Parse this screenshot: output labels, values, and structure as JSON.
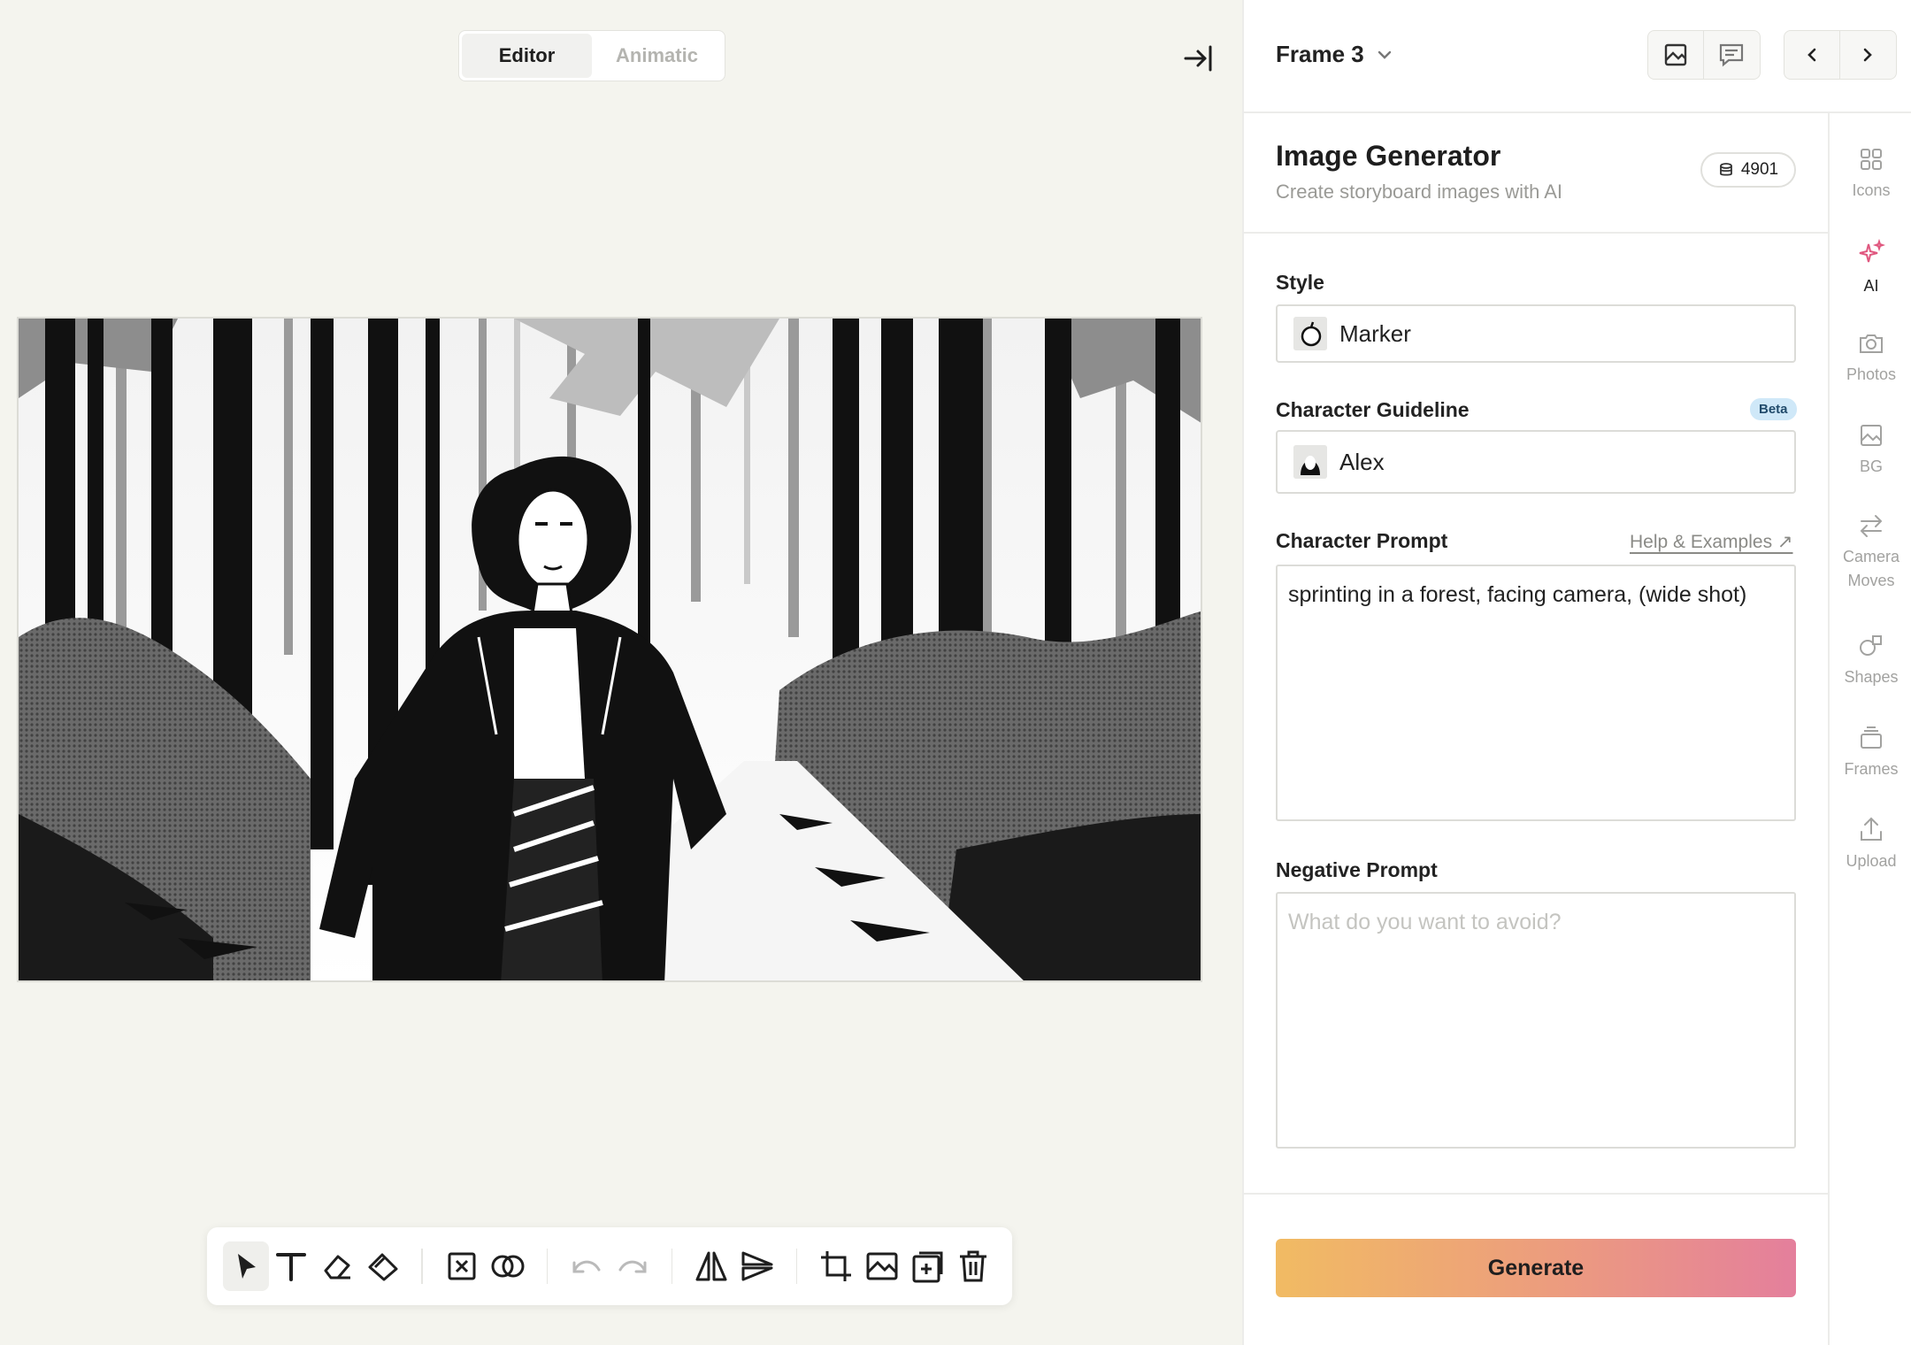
{
  "mode_toggle": {
    "editor": "Editor",
    "animatic": "Animatic",
    "active": "editor"
  },
  "toolbar": {
    "tools": [
      "select-pointer-icon",
      "text-tool-icon",
      "eraser-icon",
      "fill-tool-icon",
      "remove-element-icon",
      "merge-icon",
      "undo-icon",
      "redo-icon",
      "flip-horizontal-icon",
      "flip-vertical-icon",
      "crop-icon",
      "replace-image-icon",
      "add-frame-icon",
      "delete-icon"
    ]
  },
  "panel_header": {
    "frame_title": "Frame 3"
  },
  "generator": {
    "title": "Image Generator",
    "subtitle": "Create storyboard images with AI",
    "credits": "4901",
    "style_label": "Style",
    "style_value": "Marker",
    "character_label": "Character Guideline",
    "beta_badge": "Beta",
    "character_value": "Alex",
    "prompt_label": "Character Prompt",
    "help_link": "Help & Examples ↗",
    "prompt_value": "sprinting in a forest, facing camera, (wide shot)",
    "negative_label": "Negative Prompt",
    "negative_placeholder": "What do you want to avoid?",
    "generate_button": "Generate"
  },
  "side_rail": {
    "icons": "Icons",
    "ai": "AI",
    "photos": "Photos",
    "bg": "BG",
    "camera_moves": "Camera\nMoves",
    "shapes": "Shapes",
    "frames": "Frames",
    "upload": "Upload",
    "active": "ai"
  },
  "colors": {
    "accent_pink": "#e0577f",
    "generate_gradient": [
      "#f1bb63",
      "#ec9b7f",
      "#e47f9c"
    ],
    "beta_bg": "#cfe8f8"
  }
}
